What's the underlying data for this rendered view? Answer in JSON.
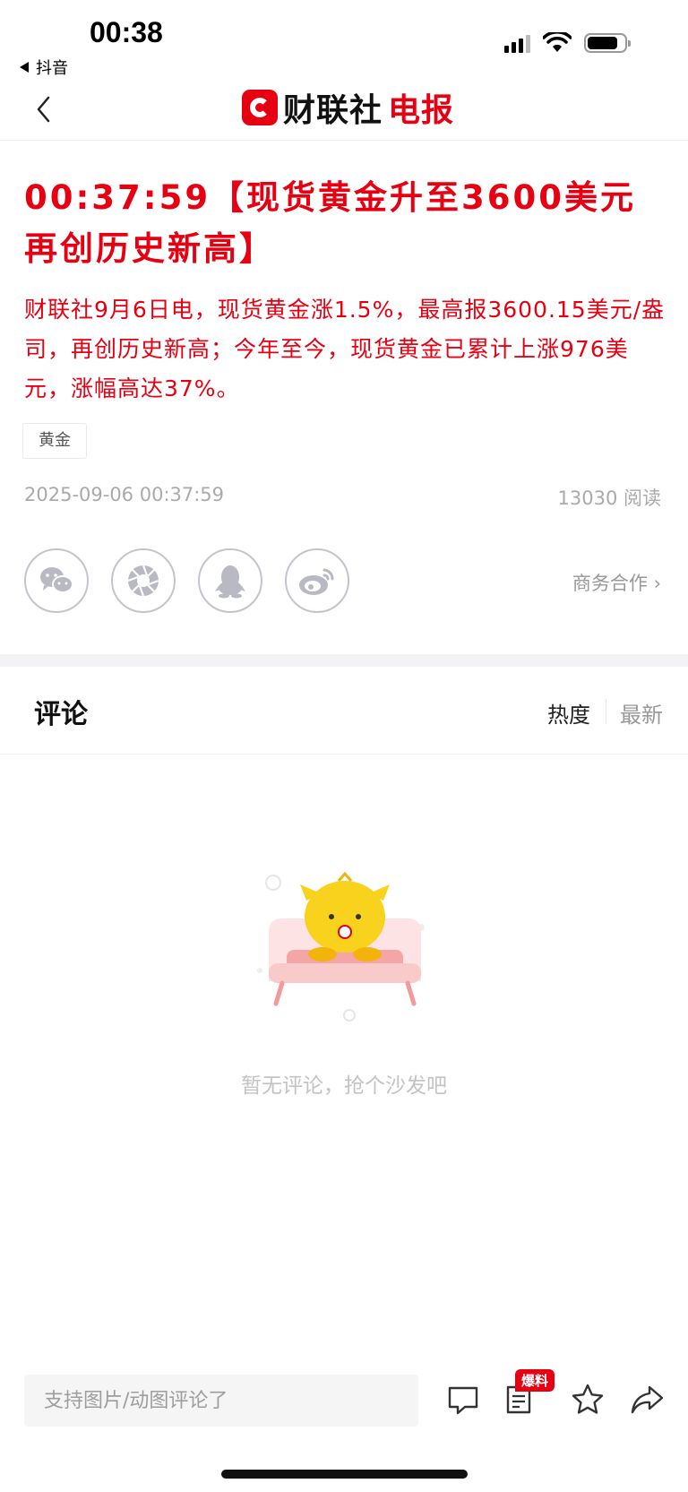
{
  "status_bar": {
    "time": "00:38",
    "back_app_label": "抖音"
  },
  "nav": {
    "logo_text_black": "财联社",
    "logo_text_red": "电报"
  },
  "article": {
    "headline": "00:37:59【现货黄金升至3600美元再创历史新高】",
    "lead": "财联社9月6日电，现货黄金涨1.5%，最高报3600.15美元/盎司，再创历史新高；今年至今，现货黄金已累计上涨976美元，涨幅高达37%。",
    "tag": "黄金",
    "datetime": "2025-09-06 00:37:59",
    "reads": "13030 阅读",
    "business_link": "商务合作 ›",
    "accent_color": "#e60012"
  },
  "share": {
    "icons": [
      "wechat-icon",
      "moments-icon",
      "qq-icon",
      "weibo-icon"
    ]
  },
  "comments": {
    "title": "评论",
    "sort_hot": "热度",
    "sort_new": "最新",
    "empty_text": "暂无评论，抢个沙发吧"
  },
  "bottom_bar": {
    "input_placeholder": "支持图片/动图评论了",
    "badge": "爆料",
    "icons": [
      "comment-icon",
      "report-icon",
      "star-icon",
      "share-icon"
    ]
  }
}
